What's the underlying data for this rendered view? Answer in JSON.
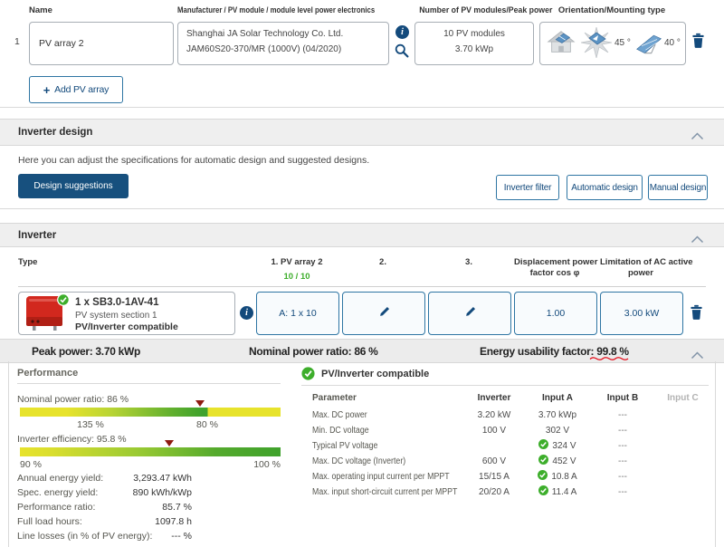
{
  "pv_arrays": {
    "col_name": "Name",
    "col_manufacturer": "Manufacturer / PV module / module level power electronics",
    "col_modules": "Number of PV modules/Peak power",
    "col_orientation": "Orientation/Mounting type",
    "row": {
      "index": "1",
      "name": "PV array 2",
      "manu_line1": "Shanghai JA Solar Technology Co. Ltd.",
      "manu_line2": "JAM60S20-370/MR (1000V) (04/2020)",
      "modules_line1": "10 PV modules",
      "modules_line2": "3.70 kWp",
      "azimuth": "45 °",
      "tilt": "40 °"
    },
    "add_plus": "+",
    "add_label": "Add PV array"
  },
  "inverter_design": {
    "title": "Inverter design",
    "description": "Here you can adjust the specifications for automatic design and suggested designs.",
    "design_suggestions": "Design suggestions",
    "inverter_filter": "Inverter filter",
    "automatic_design": "Automatic design",
    "manual_design": "Manual design"
  },
  "inverter": {
    "title": "Inverter",
    "col_type": "Type",
    "col_array1_line1": "1. PV array 2",
    "col_array1_line2": "10 / 10",
    "col_array2": "2.",
    "col_array3": "3.",
    "col_cosphi_line1": "Displacement power",
    "col_cosphi_line2": "factor cos φ",
    "col_aclimit_line1": "Limitation of AC active",
    "col_aclimit_line2": "power",
    "row": {
      "name": "1 x SB3.0-1AV-41",
      "section": "PV system section 1",
      "status": "PV/Inverter compatible",
      "input_a": "A: 1 x 10",
      "cos_phi": "1.00",
      "ac_limit": "3.00 kW"
    },
    "summary": {
      "peak_power": "Peak power: 3.70 kWp",
      "nominal_ratio": "Nominal power ratio: 86 %",
      "energy_label": "Energy usability factor: ",
      "energy_value": "99.8 %"
    }
  },
  "performance": {
    "title": "Performance",
    "bar1_label": "Nominal power ratio: 86 %",
    "bar1_tick1": "135 %",
    "bar1_tick2": "80 %",
    "bar2_label": "Inverter efficiency: 95.8 %",
    "bar2_tick_left": "90 %",
    "bar2_tick_right": "100 %",
    "stats": [
      {
        "label": "Annual energy yield:",
        "value": "3,293.47 kWh"
      },
      {
        "label": "Spec. energy yield:",
        "value": "890 kWh/kWp"
      },
      {
        "label": "Performance ratio:",
        "value": "85.7 %"
      },
      {
        "label": "Full load hours:",
        "value": "1097.8 h"
      },
      {
        "label": "Line losses (in % of PV energy):",
        "value": "--- %"
      }
    ]
  },
  "compatibility": {
    "title": "PV/Inverter compatible",
    "col_parameter": "Parameter",
    "col_inverter": "Inverter",
    "col_input_a": "Input A",
    "col_input_b": "Input B",
    "col_input_c": "Input C",
    "rows": [
      {
        "param": "Max. DC power",
        "inverter": "3.20 kW",
        "input_a": "3.70 kWp",
        "input_b": "---"
      },
      {
        "param": "Min. DC voltage",
        "inverter": "100 V",
        "input_a": "302 V",
        "input_b": "---"
      },
      {
        "param": "Typical PV voltage",
        "inverter": "",
        "input_a": "324 V",
        "input_b": "---"
      },
      {
        "param": "Max. DC voltage (Inverter)",
        "inverter": "600 V",
        "input_a": "452 V",
        "input_b": "---"
      },
      {
        "param": "Max. operating input current per MPPT",
        "inverter": "15/15 A",
        "input_a": "10.8 A",
        "input_b": "---"
      },
      {
        "param": "Max. input short-circuit current per MPPT",
        "inverter": "20/20 A",
        "input_a": "11.4 A",
        "input_b": "---"
      }
    ]
  },
  "colors": {
    "accent_blue": "#134a7c",
    "status_green": "#3dae2b",
    "device_red": "#d2281e",
    "marker_dark_red": "#8e1a10",
    "underline_red": "#e30613"
  }
}
